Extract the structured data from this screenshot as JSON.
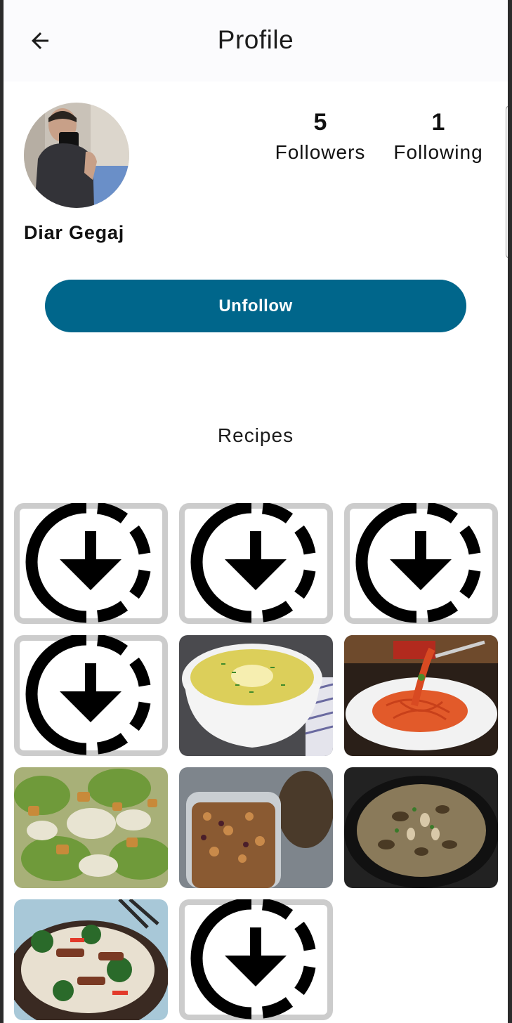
{
  "appbar": {
    "title": "Profile",
    "back_icon": "arrow-left-icon"
  },
  "profile": {
    "name": "Diar Gegaj",
    "followers_count": "5",
    "followers_label": "Followers",
    "following_count": "1",
    "following_label": "Following"
  },
  "actions": {
    "unfollow_label": "Unfollow"
  },
  "recipes": {
    "section_title": "Recipes",
    "items": [
      {
        "kind": "placeholder",
        "icon": "download-loading-icon"
      },
      {
        "kind": "placeholder",
        "icon": "download-loading-icon"
      },
      {
        "kind": "placeholder",
        "icon": "download-loading-icon"
      },
      {
        "kind": "placeholder",
        "icon": "download-loading-icon"
      },
      {
        "kind": "photo",
        "subject": "soup"
      },
      {
        "kind": "photo",
        "subject": "spaghetti"
      },
      {
        "kind": "photo",
        "subject": "caesar-salad"
      },
      {
        "kind": "photo",
        "subject": "granola"
      },
      {
        "kind": "photo",
        "subject": "risotto"
      },
      {
        "kind": "photo",
        "subject": "stir-fry"
      },
      {
        "kind": "placeholder",
        "icon": "download-loading-icon"
      }
    ]
  },
  "colors": {
    "accent": "#00668b",
    "appbar_bg": "#fbfbfd"
  }
}
